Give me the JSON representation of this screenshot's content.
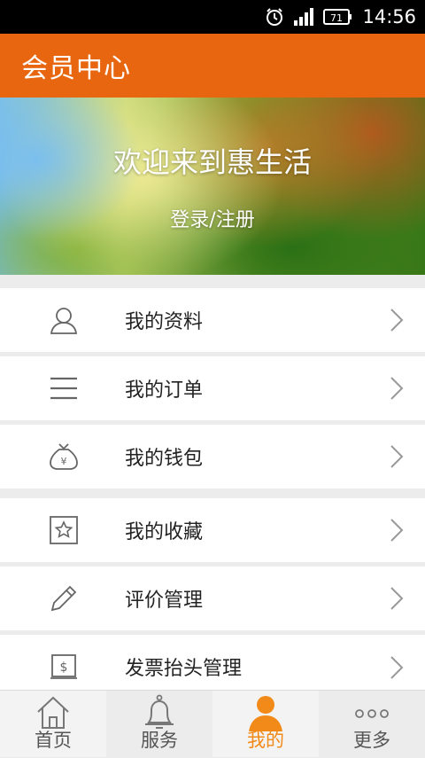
{
  "status_bar": {
    "time": "14:56",
    "battery": "71"
  },
  "app_bar": {
    "title": "会员中心"
  },
  "banner": {
    "welcome": "欢迎来到惠生活",
    "login_link": "登录/注册"
  },
  "menu": {
    "items": [
      {
        "label": "我的资料",
        "icon": "user-icon"
      },
      {
        "label": "我的订单",
        "icon": "list-icon"
      },
      {
        "label": "我的钱包",
        "icon": "money-bag-icon"
      },
      {
        "label": "我的收藏",
        "icon": "star-icon"
      },
      {
        "label": "评价管理",
        "icon": "pencil-icon"
      },
      {
        "label": "发票抬头管理",
        "icon": "invoice-icon"
      }
    ]
  },
  "tab_bar": {
    "tabs": [
      {
        "label": "首页",
        "icon": "home-icon"
      },
      {
        "label": "服务",
        "icon": "bell-icon"
      },
      {
        "label": "我的",
        "icon": "person-icon",
        "active": true
      },
      {
        "label": "更多",
        "icon": "more-icon"
      }
    ]
  },
  "colors": {
    "accent": "#e8660f",
    "tab_active": "#f28a1a"
  }
}
